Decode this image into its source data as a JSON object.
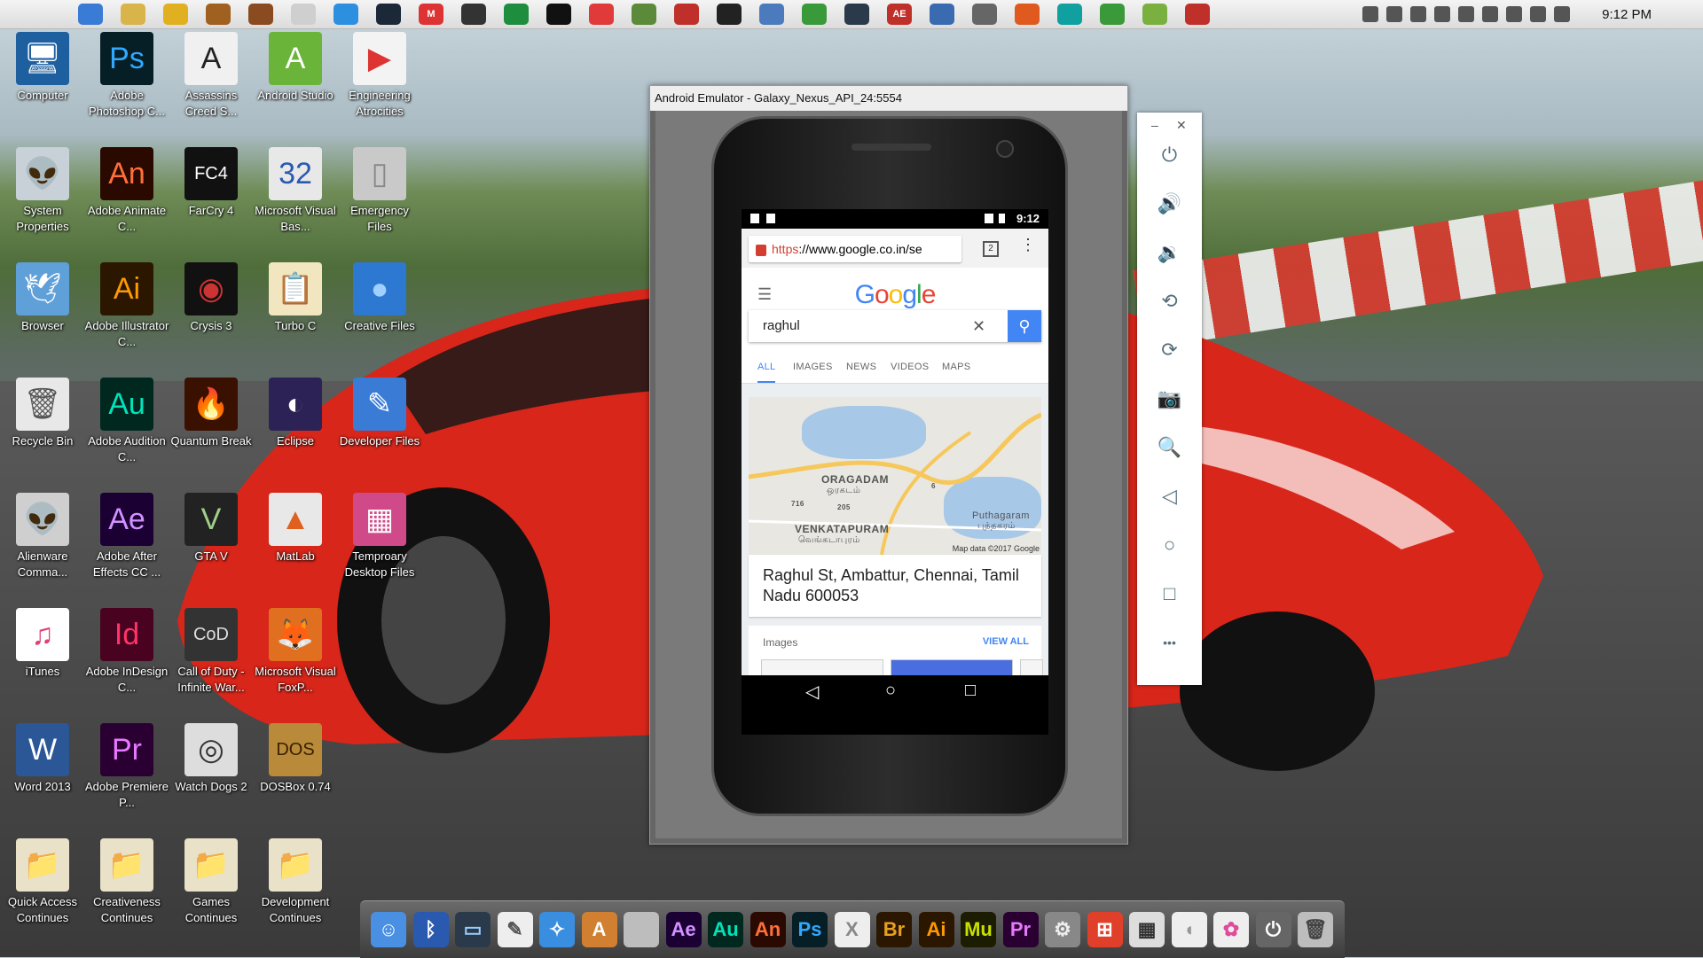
{
  "menubar": {
    "apple": "",
    "clock": "9:12 PM",
    "app_icons": [
      {
        "icon": "finder-icon",
        "color": "#3a7bd5",
        "glyph": ""
      },
      {
        "icon": "folder-icon",
        "color": "#d9b44a",
        "glyph": ""
      },
      {
        "icon": "hand-icon",
        "color": "#e0b020",
        "glyph": ""
      },
      {
        "icon": "winrar-icon",
        "color": "#a06020",
        "glyph": ""
      },
      {
        "icon": "crate-icon",
        "color": "#8a4b20",
        "glyph": ""
      },
      {
        "icon": "feather-icon",
        "color": "#cfcfcf",
        "glyph": ""
      },
      {
        "icon": "sync-icon",
        "color": "#2d8fe0",
        "glyph": ""
      },
      {
        "icon": "steam-icon",
        "color": "#1b2838",
        "glyph": ""
      },
      {
        "icon": "gmail-icon",
        "color": "#d33",
        "glyph": "M"
      },
      {
        "icon": "gear-icon",
        "color": "#333",
        "glyph": ""
      },
      {
        "icon": "sheets-icon",
        "color": "#1e8e3e",
        "glyph": ""
      },
      {
        "icon": "pycharm-icon",
        "color": "#111",
        "glyph": ""
      },
      {
        "icon": "download-icon",
        "color": "#e03a3a",
        "glyph": ""
      },
      {
        "icon": "puzzle-icon",
        "color": "#5a8a3a",
        "glyph": ""
      },
      {
        "icon": "save-icon",
        "color": "#c0302a",
        "glyph": ""
      },
      {
        "icon": "chart-icon",
        "color": "#222",
        "glyph": ""
      },
      {
        "icon": "disk-icon",
        "color": "#4b7bbd",
        "glyph": ""
      },
      {
        "icon": "globe-icon",
        "color": "#3a9a3a",
        "glyph": ""
      },
      {
        "icon": "monitor-icon",
        "color": "#2a3a4a",
        "glyph": ""
      },
      {
        "icon": "ae-icon",
        "color": "#c0302a",
        "glyph": "AE"
      },
      {
        "icon": "cube-icon",
        "color": "#3a6ab0",
        "glyph": ""
      },
      {
        "icon": "database-icon",
        "color": "#666",
        "glyph": ""
      },
      {
        "icon": "brush-icon",
        "color": "#e05a20",
        "glyph": ""
      },
      {
        "icon": "arduino-icon",
        "color": "#10a0a0",
        "glyph": ""
      },
      {
        "icon": "android-studio-icon",
        "color": "#3a9a3a",
        "glyph": ""
      },
      {
        "icon": "battery-icon",
        "color": "#7ab040",
        "glyph": ""
      },
      {
        "icon": "acrobat-icon",
        "color": "#c0302a",
        "glyph": ""
      }
    ]
  },
  "desktop": [
    {
      "name": "computer-icon",
      "label": "Computer",
      "glyph": "🖥",
      "bg": "#1e5fa0",
      "fg": "#fff"
    },
    {
      "name": "adobe-photoshop-icon",
      "label": "Adobe Photoshop C...",
      "glyph": "Ps",
      "bg": "#061e26",
      "fg": "#31a8ff"
    },
    {
      "name": "assassins-creed-icon",
      "label": "Assassins Creed S...",
      "glyph": "A",
      "bg": "#f0f0f0",
      "fg": "#222"
    },
    {
      "name": "android-studio-icon",
      "label": "Android Studio",
      "glyph": "A",
      "bg": "#6bb43a",
      "fg": "#fff"
    },
    {
      "name": "engineering-atrocities-icon",
      "label": "Engineering Atrocities",
      "glyph": "▶",
      "bg": "#f3f3f3",
      "fg": "#d33"
    },
    {
      "name": "system-properties-icon",
      "label": "System Properties",
      "glyph": "👽",
      "bg": "#c8d0d8",
      "fg": "#222"
    },
    {
      "name": "adobe-animate-icon",
      "label": "Adobe Animate C...",
      "glyph": "An",
      "bg": "#2a0a00",
      "fg": "#ff6f3c"
    },
    {
      "name": "farcry-icon",
      "label": "FarCry 4",
      "glyph": "FC4",
      "bg": "#111",
      "fg": "#fff"
    },
    {
      "name": "visual-basic-icon",
      "label": "Microsoft Visual Bas...",
      "glyph": "32",
      "bg": "#e8e8e8",
      "fg": "#2a5ab0"
    },
    {
      "name": "emergency-files-icon",
      "label": "Emergency Files",
      "glyph": "▯",
      "bg": "#c9c9c9",
      "fg": "#888"
    },
    {
      "name": "browser-icon",
      "label": "Browser",
      "glyph": "🕊",
      "bg": "#5fa0d8",
      "fg": "#fff"
    },
    {
      "name": "adobe-illustrator-icon",
      "label": "Adobe Illustrator C...",
      "glyph": "Ai",
      "bg": "#2b1600",
      "fg": "#ff9a00"
    },
    {
      "name": "crysis-icon",
      "label": "Crysis 3",
      "glyph": "◉",
      "bg": "#111",
      "fg": "#c33"
    },
    {
      "name": "turbo-c-icon",
      "label": "Turbo C",
      "glyph": "📋",
      "bg": "#f2e6c0",
      "fg": "#333"
    },
    {
      "name": "creative-files-icon",
      "label": "Creative Files",
      "glyph": "●",
      "bg": "#2d78d0",
      "fg": "#9fd0ff"
    },
    {
      "name": "recycle-bin-icon",
      "label": "Recycle Bin",
      "glyph": "🗑",
      "bg": "#e8e8e8",
      "fg": "#555"
    },
    {
      "name": "adobe-audition-icon",
      "label": "Adobe Audition C...",
      "glyph": "Au",
      "bg": "#00281f",
      "fg": "#00e4bb"
    },
    {
      "name": "quantum-break-icon",
      "label": "Quantum Break",
      "glyph": "🔥",
      "bg": "#3a1000",
      "fg": "#ff8a00"
    },
    {
      "name": "eclipse-icon",
      "label": "Eclipse",
      "glyph": "◐",
      "bg": "#2c2255",
      "fg": "#fff"
    },
    {
      "name": "developer-files-icon",
      "label": "Developer Files",
      "glyph": "✎",
      "bg": "#3a7bd5",
      "fg": "#fff"
    },
    {
      "name": "alienware-icon",
      "label": "Alienware Comma...",
      "glyph": "👽",
      "bg": "#cfcfcf",
      "fg": "#333"
    },
    {
      "name": "adobe-after-effects-icon",
      "label": "Adobe After Effects CC ...",
      "glyph": "Ae",
      "bg": "#1a0033",
      "fg": "#d291ff"
    },
    {
      "name": "gta-v-icon",
      "label": "GTA V",
      "glyph": "V",
      "bg": "#222",
      "fg": "#9fd08a"
    },
    {
      "name": "matlab-icon",
      "label": "MatLab",
      "glyph": "▲",
      "bg": "#e8e8e8",
      "fg": "#e06020"
    },
    {
      "name": "temporary-files-icon",
      "label": "Temproary Desktop Files",
      "glyph": "▦",
      "bg": "#d04a8a",
      "fg": "#fff"
    },
    {
      "name": "itunes-icon",
      "label": "iTunes",
      "glyph": "♫",
      "bg": "#fff",
      "fg": "#e0407a"
    },
    {
      "name": "adobe-indesign-icon",
      "label": "Adobe InDesign C...",
      "glyph": "Id",
      "bg": "#49021f",
      "fg": "#ff3366"
    },
    {
      "name": "call-of-duty-icon",
      "label": "Call of Duty - Infinite War...",
      "glyph": "CoD",
      "bg": "#333",
      "fg": "#ddd"
    },
    {
      "name": "visual-foxpro-icon",
      "label": "Microsoft Visual FoxP...",
      "glyph": "🦊",
      "bg": "#e07020",
      "fg": "#fff"
    },
    {
      "name": "word-icon",
      "label": "Word 2013",
      "glyph": "W",
      "bg": "#2b5797",
      "fg": "#fff"
    },
    {
      "name": "adobe-premiere-icon",
      "label": "Adobe Premiere P...",
      "glyph": "Pr",
      "bg": "#2a0033",
      "fg": "#ea77ff"
    },
    {
      "name": "watch-dogs-icon",
      "label": "Watch Dogs 2",
      "glyph": "◎",
      "bg": "#ddd",
      "fg": "#333"
    },
    {
      "name": "dosbox-icon",
      "label": "DOSBox 0.74",
      "glyph": "DOS",
      "bg": "#b88a3a",
      "fg": "#3a2000"
    },
    {
      "name": "quick-access-icon",
      "label": "Quick Access Continues",
      "glyph": "📁",
      "bg": "#e9e2c8",
      "fg": "#333"
    },
    {
      "name": "creativeness-icon",
      "label": "Creativeness Continues",
      "glyph": "📁",
      "bg": "#e9e2c8",
      "fg": "#333"
    },
    {
      "name": "games-icon",
      "label": "Games Continues",
      "glyph": "📁",
      "bg": "#e9e2c8",
      "fg": "#333"
    },
    {
      "name": "development-icon",
      "label": "Development Continues",
      "glyph": "📁",
      "bg": "#e9e2c8",
      "fg": "#333"
    }
  ],
  "emulator": {
    "title": "Android Emulator - Galaxy_Nexus_API_24:5554",
    "status_time": "9:12",
    "url_https": "https",
    "url_rest": "://www.google.co.in/se",
    "tab_count": "2",
    "logo": "Google",
    "search_value": "raghul",
    "tabs": [
      "ALL",
      "IMAGES",
      "NEWS",
      "VIDEOS",
      "MAPS"
    ],
    "map_labels": [
      "ORAGADAM",
      "ஒரகடம்",
      "VENKATAPURAM",
      "வெங்கடாபுரம்",
      "Puthagaram",
      "புத்தகரம்",
      "716",
      "205",
      "6"
    ],
    "map_copyright": "Map data ©2017 Google",
    "address": "Raghul St, Ambattur, Chennai, Tamil Nadu 600053",
    "images_title": "Images",
    "view_all": "VIEW ALL"
  },
  "side_controls": [
    {
      "name": "power-icon",
      "glyph": "⏻"
    },
    {
      "name": "volume-up-icon",
      "glyph": "🔊"
    },
    {
      "name": "volume-down-icon",
      "glyph": "🔉"
    },
    {
      "name": "rotate-left-icon",
      "glyph": "⟲"
    },
    {
      "name": "rotate-right-icon",
      "glyph": "⟳"
    },
    {
      "name": "camera-icon",
      "glyph": "📷"
    },
    {
      "name": "zoom-icon",
      "glyph": "🔍"
    },
    {
      "name": "back-icon",
      "glyph": "◁"
    },
    {
      "name": "home-icon",
      "glyph": "○"
    },
    {
      "name": "overview-icon",
      "glyph": "□"
    },
    {
      "name": "more-icon",
      "glyph": "•••"
    }
  ],
  "dock": [
    {
      "name": "finder-icon",
      "glyph": "☺",
      "bg": "#4a90e2",
      "fg": "#fff"
    },
    {
      "name": "bluetooth-icon",
      "glyph": "ᛒ",
      "bg": "#2a5ab0",
      "fg": "#fff"
    },
    {
      "name": "monitor-icon",
      "glyph": "▭",
      "bg": "#2a3a4a",
      "fg": "#9cf"
    },
    {
      "name": "notes-icon",
      "glyph": "✎",
      "bg": "#eee",
      "fg": "#555"
    },
    {
      "name": "safari-icon",
      "glyph": "✧",
      "bg": "#3a8ee0",
      "fg": "#fff"
    },
    {
      "name": "app-store-icon",
      "glyph": "A",
      "bg": "#d08030",
      "fg": "#fff"
    },
    {
      "name": "blank-icon",
      "glyph": "",
      "bg": "#bdbdbd",
      "fg": "#333"
    },
    {
      "name": "after-effects-icon",
      "glyph": "Ae",
      "bg": "#1a0033",
      "fg": "#d291ff"
    },
    {
      "name": "audition-icon",
      "glyph": "Au",
      "bg": "#00281f",
      "fg": "#00e4bb"
    },
    {
      "name": "animate-icon",
      "glyph": "An",
      "bg": "#2a0a00",
      "fg": "#ff6f3c"
    },
    {
      "name": "photoshop-icon",
      "glyph": "Ps",
      "bg": "#061e26",
      "fg": "#31a8ff"
    },
    {
      "name": "osx-icon",
      "glyph": "X",
      "bg": "#eee",
      "fg": "#888"
    },
    {
      "name": "bridge-icon",
      "glyph": "Br",
      "bg": "#2b1600",
      "fg": "#e8a020"
    },
    {
      "name": "illustrator-icon",
      "glyph": "Ai",
      "bg": "#2b1600",
      "fg": "#ff9a00"
    },
    {
      "name": "muse-icon",
      "glyph": "Mu",
      "bg": "#1c1c00",
      "fg": "#c8e000"
    },
    {
      "name": "premiere-icon",
      "glyph": "Pr",
      "bg": "#2a0033",
      "fg": "#ea77ff"
    },
    {
      "name": "settings-icon",
      "glyph": "⚙",
      "bg": "#888",
      "fg": "#eee"
    },
    {
      "name": "windows-icon",
      "glyph": "⊞",
      "bg": "#e0402a",
      "fg": "#fff"
    },
    {
      "name": "calculator-icon",
      "glyph": "▦",
      "bg": "#ddd",
      "fg": "#333"
    },
    {
      "name": "mouse-icon",
      "glyph": "◖",
      "bg": "#eee",
      "fg": "#999"
    },
    {
      "name": "color-wheel-icon",
      "glyph": "✿",
      "bg": "#eee",
      "fg": "#e04a9a"
    },
    {
      "name": "shutdown-icon",
      "glyph": "⏻",
      "bg": "#666",
      "fg": "#fff"
    },
    {
      "name": "trash-icon",
      "glyph": "🗑",
      "bg": "#bdbdbd",
      "fg": "#444"
    }
  ]
}
